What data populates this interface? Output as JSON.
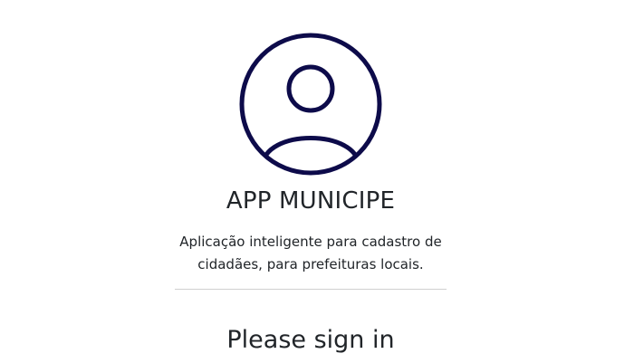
{
  "logo": {
    "icon": "user-circle-icon",
    "color": "#0d0b4a"
  },
  "app": {
    "title": "APP MUNICIPE",
    "description": "Aplicação inteligente para cadastro de cidadães, para prefeituras locais."
  },
  "signin": {
    "heading": "Please sign in"
  }
}
